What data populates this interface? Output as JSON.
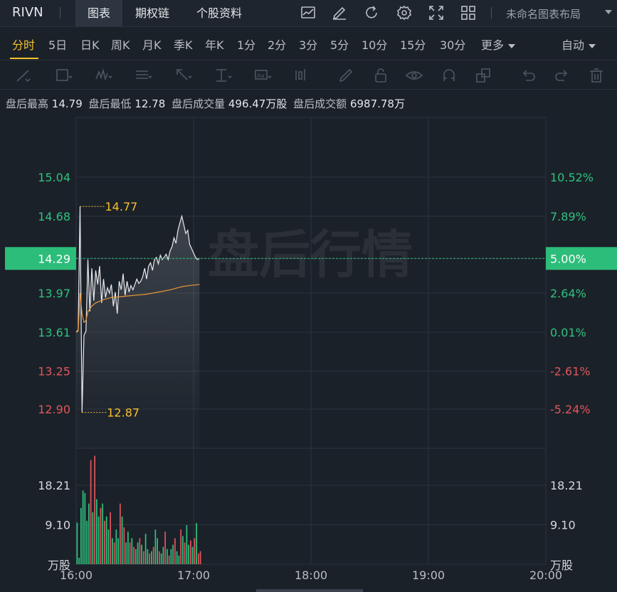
{
  "topbar": {
    "symbol": "RIVN",
    "tabs": [
      "图表",
      "期权链",
      "个股资料"
    ],
    "active_tab": 0,
    "layout_name": "未命名图表布局",
    "icons": [
      "indicator-icon",
      "draw-pen-icon",
      "refresh-icon",
      "settings-icon",
      "fullscreen-icon",
      "layout-grid-icon"
    ]
  },
  "periods": {
    "items": [
      "分时",
      "5日",
      "日K",
      "周K",
      "月K",
      "季K",
      "年K",
      "1分",
      "2分",
      "3分",
      "5分",
      "10分",
      "15分",
      "30分",
      "更多"
    ],
    "active": "分时",
    "right_label": "自动"
  },
  "drawing_tools": [
    "line-tool-icon",
    "rectangle-tool-icon",
    "wave-tool-icon",
    "fib-tool-icon",
    "arrow-tool-icon",
    "text-tool-icon",
    "label-tool-icon",
    "bar-pattern-icon",
    "pen-icon",
    "lock-icon",
    "eye-icon",
    "magnet-icon",
    "duplicate-icon",
    "undo-icon",
    "redo-icon",
    "trash-icon"
  ],
  "info": {
    "high_label": "盘后最高",
    "high": "14.79",
    "low_label": "盘后最低",
    "low": "12.78",
    "volume_label": "盘后成交量",
    "volume": "496.47万股",
    "turnover_label": "盘后成交额",
    "turnover": "6987.78万"
  },
  "colors": {
    "up": "#2ec27e",
    "down": "#e0565b",
    "price_line": "#e8eaed",
    "avg_line": "#e8963a",
    "marker": "#f5c12b",
    "highlight": "#2dbd7a"
  },
  "chart_data": {
    "type": "line",
    "watermark": "盘后行情",
    "x_ticks": [
      "16:00",
      "17:00",
      "18:00",
      "19:00",
      "20:00"
    ],
    "xlim": [
      "16:00",
      "20:00"
    ],
    "price_axis": [
      "15.04",
      "14.68",
      "14.29",
      "13.97",
      "13.61",
      "13.25",
      "12.90"
    ],
    "price_axis_values": [
      15.04,
      14.68,
      14.29,
      13.97,
      13.61,
      13.25,
      12.9
    ],
    "pct_axis": [
      "10.52%",
      "7.89%",
      "5.00%",
      "2.64%",
      "0.01%",
      "-2.61%",
      "-5.24%"
    ],
    "ylim": [
      12.9,
      15.04
    ],
    "current_price": "14.29",
    "current_pct": "5.00%",
    "high_marker": "14.77",
    "low_marker": "12.87",
    "price_series": {
      "x_minutes": [
        0,
        1,
        2,
        3,
        4,
        5,
        6,
        7,
        8,
        9,
        10,
        11,
        12,
        13,
        14,
        15,
        16,
        17,
        18,
        19,
        20,
        21,
        22,
        23,
        24,
        25,
        26,
        27,
        28,
        29,
        30,
        31,
        32,
        33,
        34,
        35,
        36,
        37,
        38,
        39,
        40,
        41,
        42,
        43,
        44,
        45,
        46,
        47,
        48,
        49,
        50,
        51,
        52,
        53,
        54,
        55,
        56,
        57,
        58,
        59,
        60,
        61,
        62,
        63
      ],
      "values": [
        13.61,
        13.63,
        14.77,
        12.87,
        13.58,
        13.62,
        14.28,
        13.8,
        14.2,
        13.9,
        14.18,
        14.05,
        14.22,
        13.88,
        14.1,
        13.93,
        14.02,
        13.97,
        14.05,
        13.85,
        13.98,
        13.78,
        14.08,
        14.0,
        14.15,
        13.95,
        14.08,
        13.98,
        14.04,
        14.0,
        14.05,
        14.1,
        14.06,
        14.08,
        14.12,
        14.2,
        14.1,
        14.22,
        14.25,
        14.18,
        14.28,
        14.3,
        14.24,
        14.32,
        14.28,
        14.3,
        14.33,
        14.28,
        14.36,
        14.4,
        14.48,
        14.43,
        14.55,
        14.62,
        14.68,
        14.6,
        14.52,
        14.55,
        14.42,
        14.38,
        14.34,
        14.3,
        14.28,
        14.29
      ]
    },
    "avg_series": {
      "x_minutes": [
        0,
        1,
        2,
        3,
        4,
        5,
        6,
        8,
        10,
        14,
        18,
        24,
        30,
        36,
        42,
        48,
        54,
        58,
        63
      ],
      "values": [
        13.61,
        13.62,
        13.97,
        13.78,
        13.7,
        13.72,
        13.8,
        13.85,
        13.88,
        13.91,
        13.93,
        13.94,
        13.95,
        13.96,
        13.98,
        14.0,
        14.03,
        14.04,
        14.05
      ]
    },
    "volume": {
      "unit": "万股",
      "axis": [
        "18.21",
        "9.10"
      ],
      "axis_values": [
        18.21,
        9.1
      ],
      "values": [
        9.6,
        1.5,
        13.0,
        17.0,
        16.4,
        10.0,
        14.0,
        24.0,
        12.0,
        25.0,
        15.0,
        11.0,
        13.0,
        14.0,
        10.0,
        11.0,
        8.0,
        12.0,
        6.0,
        5.0,
        8.0,
        6.0,
        14.0,
        11.0,
        8.5,
        5.0,
        7.5,
        5.0,
        6.0,
        4.0,
        3.5,
        5.0,
        6.0,
        4.5,
        3.0,
        7.0,
        3.5,
        2.5,
        3.0,
        4.0,
        8.0,
        6.0,
        3.0,
        2.5,
        4.0,
        7.5,
        3.5,
        2.0,
        3.5,
        4.5,
        6.0,
        3.0,
        2.0,
        8.0,
        6.5,
        5.0,
        9.0,
        4.5,
        5.5,
        4.0,
        6.0,
        9.5,
        2.5,
        3.0
      ],
      "up": [
        1,
        1,
        1,
        1,
        1,
        1,
        1,
        0,
        1,
        0,
        1,
        1,
        0,
        1,
        0,
        1,
        1,
        0,
        1,
        0,
        1,
        1,
        0,
        1,
        0,
        1,
        1,
        0,
        1,
        0,
        1,
        1,
        0,
        1,
        0,
        1,
        1,
        0,
        1,
        0,
        1,
        1,
        0,
        1,
        1,
        0,
        1,
        0,
        1,
        1,
        0,
        1,
        1,
        0,
        1,
        0,
        1,
        1,
        0,
        1,
        0,
        1,
        0,
        0
      ]
    }
  }
}
